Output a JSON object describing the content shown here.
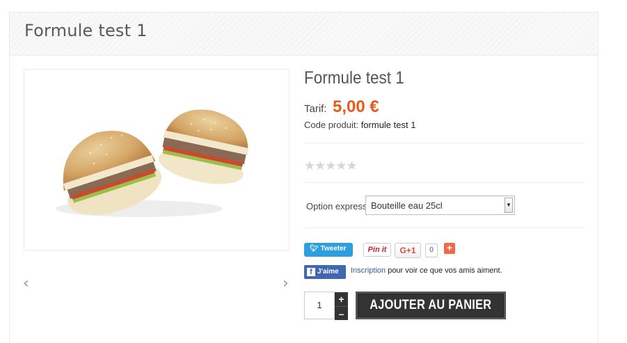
{
  "page": {
    "title": "Formule test 1"
  },
  "gallery": {
    "prev_arrow": "‹",
    "next_arrow": "›"
  },
  "product": {
    "name": "Formule test 1",
    "price_label": "Tarif:",
    "price": "5,00 €",
    "ref_label": "Code produit:",
    "ref_value": "formule test 1",
    "rating_stars": "★★★★★",
    "option_label": "Option express",
    "option_selected": "Bouteille eau 25cl"
  },
  "social": {
    "tweet": "Tweeter",
    "pinit": "Pin it",
    "gplus": "G+1",
    "gplus_count": "0",
    "gplus_add": "+",
    "fb_like": "J'aime",
    "fb_link": "Inscription",
    "fb_text": " pour voir ce que vos amis aiment."
  },
  "cart": {
    "qty": "1",
    "plus": "+",
    "minus": "–",
    "add_label": "AJOUTER AU PANIER"
  },
  "colors": {
    "price": "#e85a17",
    "tweet": "#2b9fdf",
    "facebook": "#4267b2",
    "pinterest": "#cb2027",
    "button": "#333333"
  }
}
